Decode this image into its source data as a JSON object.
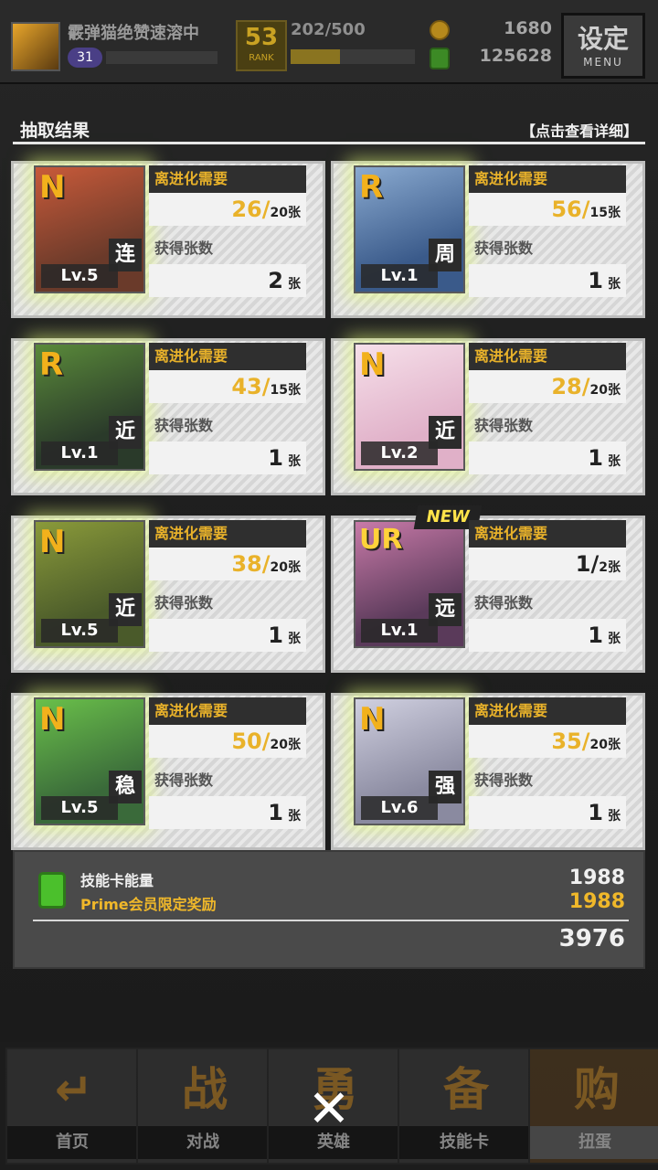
{
  "topbar": {
    "player_name": "霰弹猫绝赞速溶中",
    "player_level": "31",
    "rank": "53",
    "rank_label": "RANK",
    "stamina": "202/500",
    "stamina_fraction": 0.4,
    "coins": "1680",
    "energy": "125628",
    "menu_big": "设定",
    "menu_small": "MENU"
  },
  "header": {
    "title": "抽取结果",
    "detail_link": "【点击查看详细】"
  },
  "labels": {
    "evo_label": "离进化需要",
    "get_label": "获得张数",
    "unit": "张",
    "new_badge": "NEW"
  },
  "cards": [
    {
      "rarity": "N",
      "type": "连",
      "level": "Lv.5",
      "evo_have": "26",
      "evo_need": "20",
      "obtained": "2"
    },
    {
      "rarity": "R",
      "type": "周",
      "level": "Lv.1",
      "evo_have": "56",
      "evo_need": "15",
      "obtained": "1"
    },
    {
      "rarity": "R",
      "type": "近",
      "level": "Lv.1",
      "evo_have": "43",
      "evo_need": "15",
      "obtained": "1"
    },
    {
      "rarity": "N",
      "type": "近",
      "level": "Lv.2",
      "evo_have": "28",
      "evo_need": "20",
      "obtained": "1"
    },
    {
      "rarity": "N",
      "type": "近",
      "level": "Lv.5",
      "evo_have": "38",
      "evo_need": "20",
      "obtained": "1"
    },
    {
      "rarity": "UR",
      "type": "远",
      "level": "Lv.1",
      "evo_have": "1",
      "evo_need": "2",
      "obtained": "1"
    },
    {
      "rarity": "N",
      "type": "稳",
      "level": "Lv.5",
      "evo_have": "50",
      "evo_need": "20",
      "obtained": "1"
    },
    {
      "rarity": "N",
      "type": "强",
      "level": "Lv.6",
      "evo_have": "35",
      "evo_need": "20",
      "obtained": "1"
    }
  ],
  "reward": {
    "label": "技能卡能量",
    "value": "1988",
    "bonus_label": "Prime会员限定奖励",
    "bonus_value": "1988",
    "total": "3976"
  },
  "nav": [
    {
      "label": "首页",
      "glyph": "↵"
    },
    {
      "label": "对战",
      "glyph": "战"
    },
    {
      "label": "英雄",
      "glyph": "勇"
    },
    {
      "label": "技能卡",
      "glyph": "备"
    },
    {
      "label": "扭蛋",
      "glyph": "购"
    }
  ],
  "close_glyph": "✕",
  "colors": {
    "accent_gold": "#e9b22a",
    "card_bg": "#dcdcdc",
    "panel_bg": "#4a4a4a"
  }
}
